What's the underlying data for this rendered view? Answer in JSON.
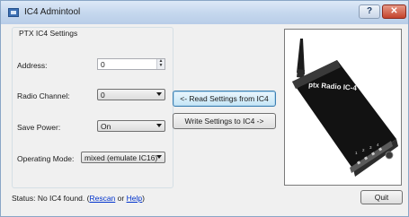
{
  "window": {
    "title": "IC4 Admintool",
    "help_label": "?",
    "close_label": "✕"
  },
  "settings": {
    "group_label": "PTX IC4 Settings",
    "address_label": "Address:",
    "address_value": "0",
    "radio_channel_label": "Radio Channel:",
    "radio_channel_value": "0",
    "save_power_label": "Save Power:",
    "save_power_value": "On",
    "operating_mode_label": "Operating Mode:",
    "operating_mode_value": "mixed (emulate IC16)"
  },
  "actions": {
    "read_label": "<- Read Settings from IC4",
    "write_label": "Write Settings to IC4 ->",
    "quit_label": "Quit"
  },
  "device_photo": {
    "brand_text": "ptx Radio IC-4",
    "port_labels": [
      "1",
      "2",
      "3",
      "4"
    ]
  },
  "status": {
    "prefix": "Status:  No IC4 found. (",
    "rescan_label": "Rescan",
    "or_text": " or ",
    "help_label": "Help",
    "suffix": ")"
  }
}
